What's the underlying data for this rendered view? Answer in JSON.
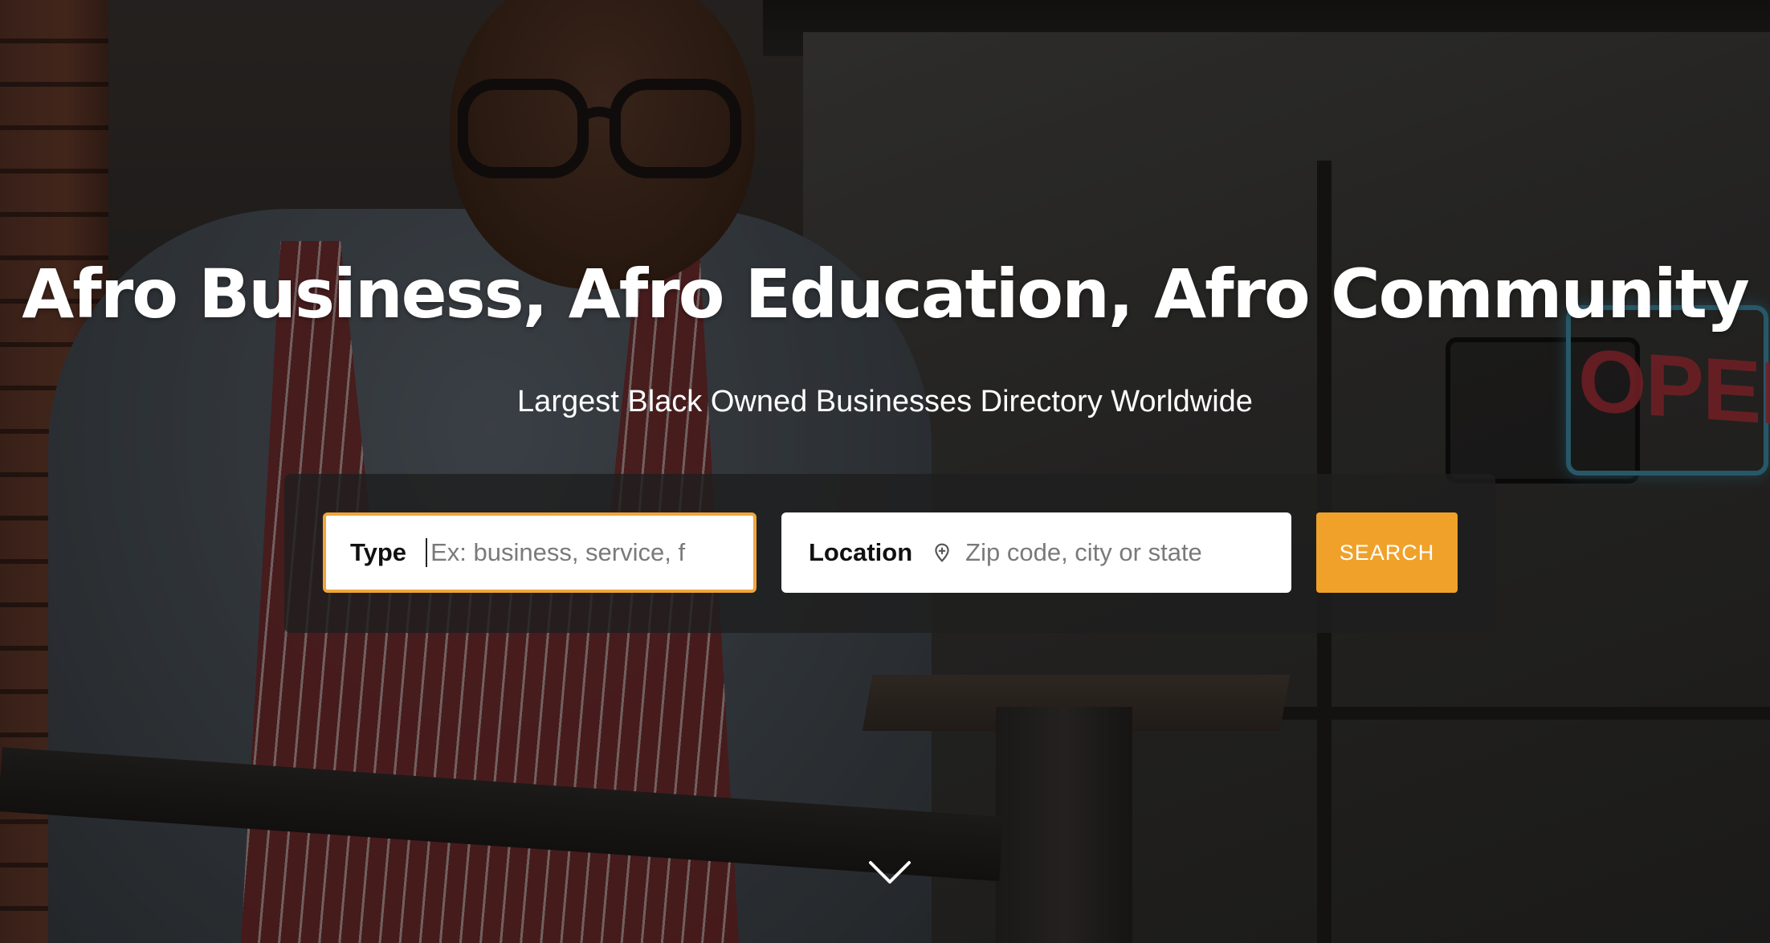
{
  "hero": {
    "title": "Afro Business, Afro Education, Afro Community",
    "subtitle": "Largest Black Owned Businesses Directory Worldwide",
    "background_sign_text": "OPEN"
  },
  "search": {
    "type_label": "Type",
    "type_placeholder": "Ex: business, service, f",
    "location_label": "Location",
    "location_placeholder": "Zip code, city or state",
    "location_icon": "map-pin-icon",
    "button_label": "SEARCH"
  },
  "scroll": {
    "icon": "chevron-down-icon"
  },
  "colors": {
    "accent": "#f0a12a",
    "focus_border": "#f0a63a",
    "panel": "#1e1e1e",
    "text_on_dark": "#ffffff"
  }
}
